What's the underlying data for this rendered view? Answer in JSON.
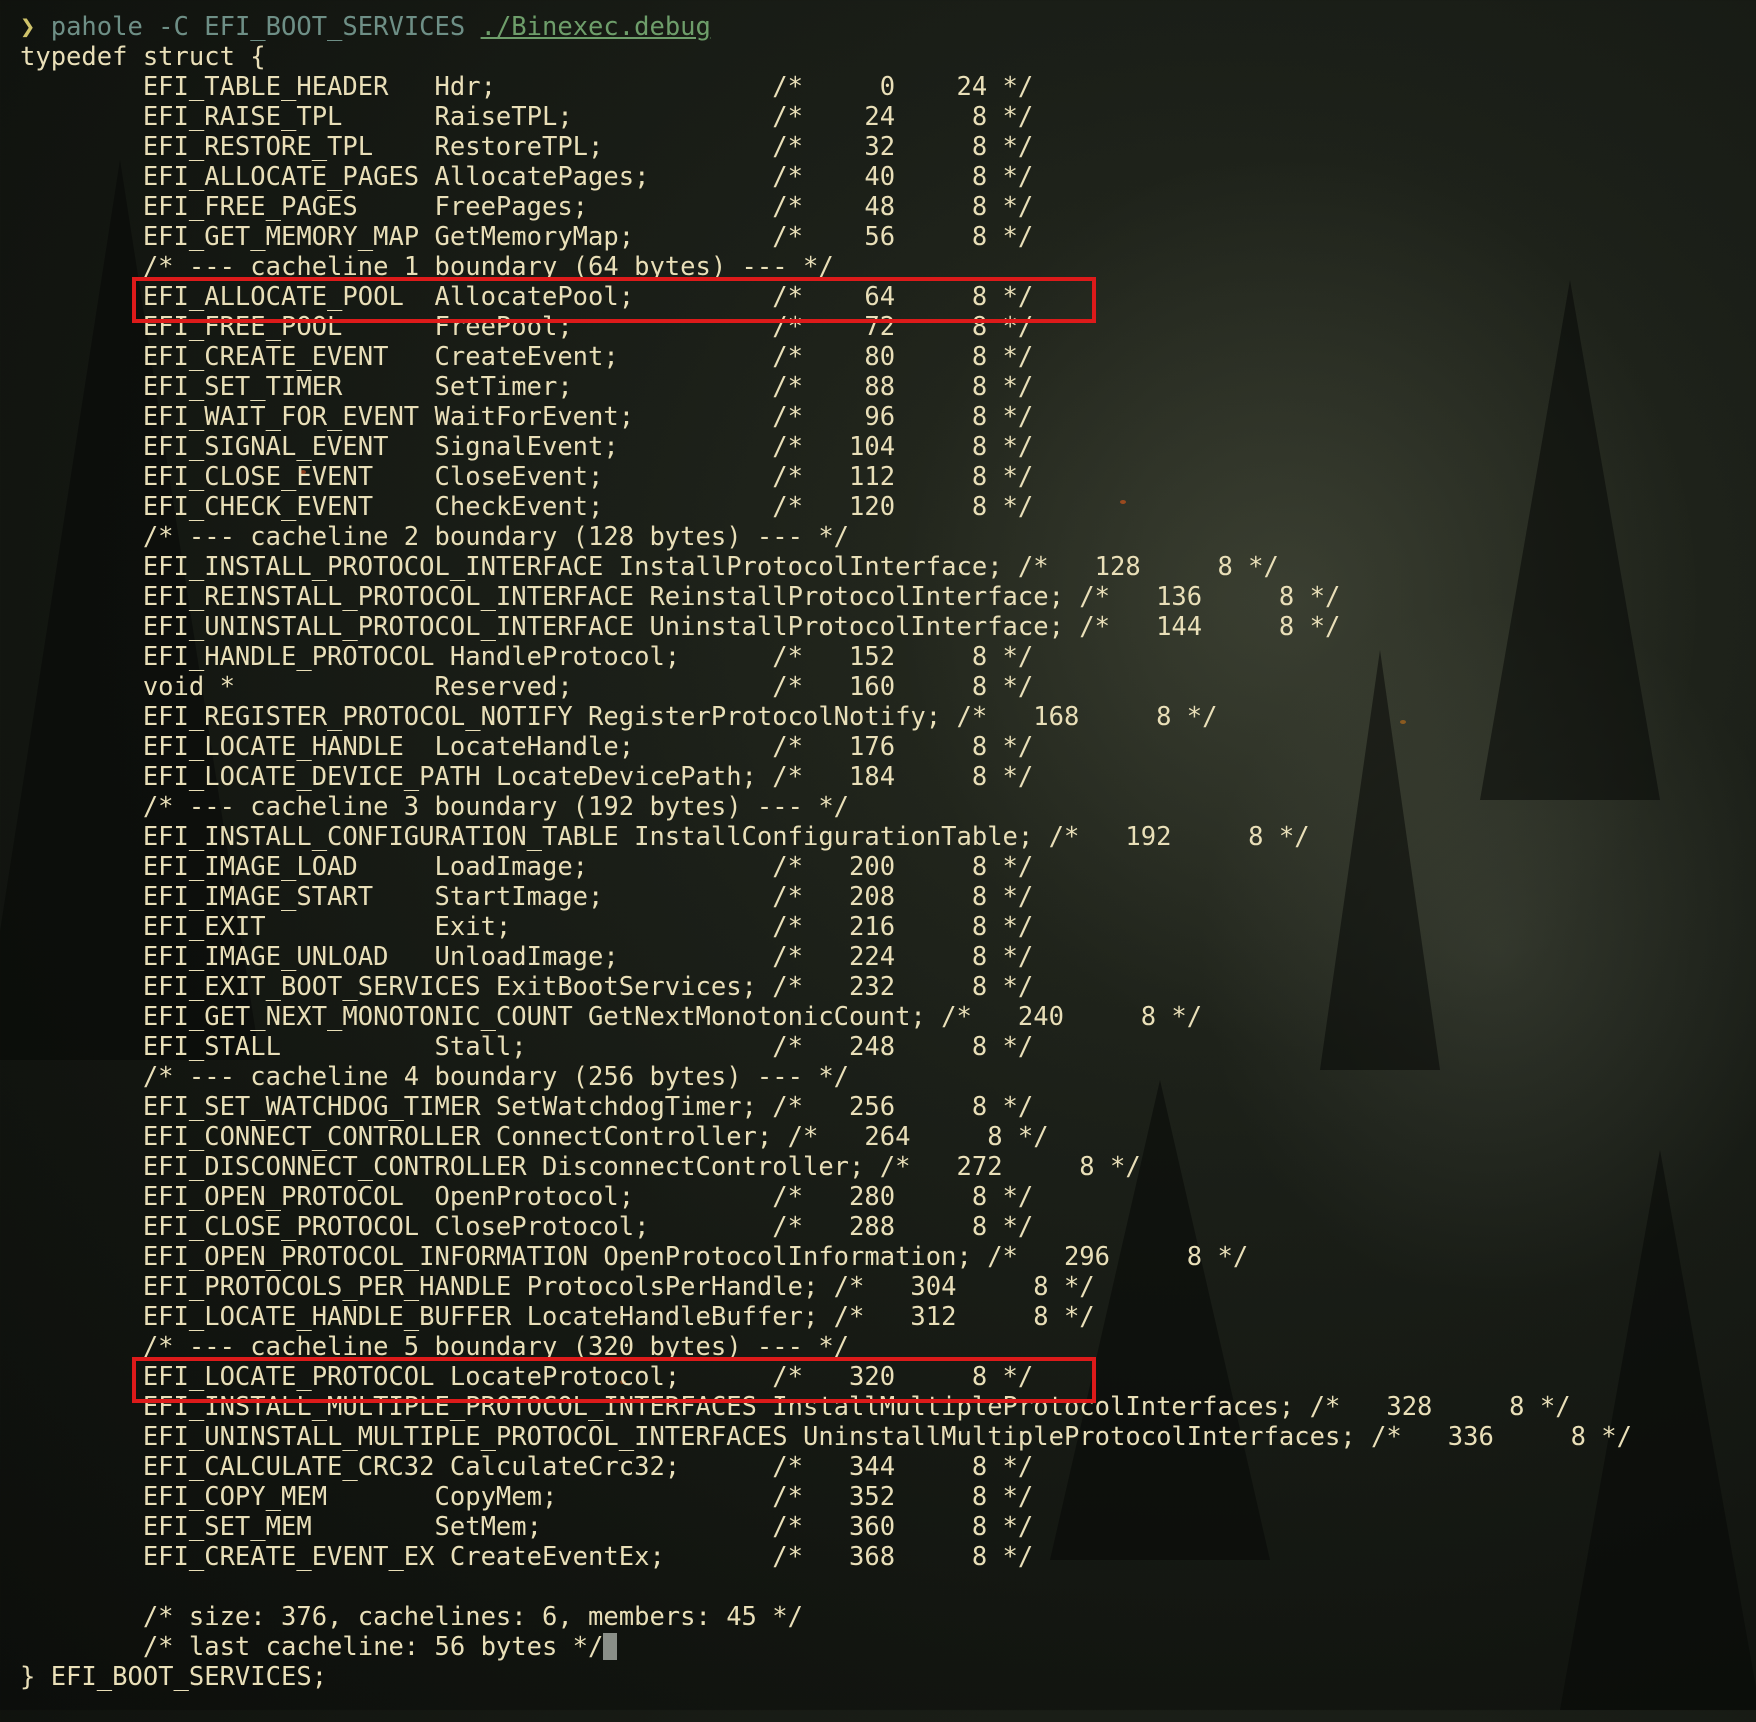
{
  "prompt": {
    "arrow": "❯",
    "command": "pahole -C EFI_BOOT_SERVICES",
    "path": "./Binexec.debug"
  },
  "header": "typedef struct {",
  "lines": [
    "        EFI_TABLE_HEADER   Hdr;                  /*     0    24 */",
    "        EFI_RAISE_TPL      RaiseTPL;             /*    24     8 */",
    "        EFI_RESTORE_TPL    RestoreTPL;           /*    32     8 */",
    "        EFI_ALLOCATE_PAGES AllocatePages;        /*    40     8 */",
    "        EFI_FREE_PAGES     FreePages;            /*    48     8 */",
    "        EFI_GET_MEMORY_MAP GetMemoryMap;         /*    56     8 */",
    "        /* --- cacheline 1 boundary (64 bytes) --- */",
    "        EFI_ALLOCATE_POOL  AllocatePool;         /*    64     8 */",
    "        EFI_FREE_POOL      FreePool;             /*    72     8 */",
    "        EFI_CREATE_EVENT   CreateEvent;          /*    80     8 */",
    "        EFI_SET_TIMER      SetTimer;             /*    88     8 */",
    "        EFI_WAIT_FOR_EVENT WaitForEvent;         /*    96     8 */",
    "        EFI_SIGNAL_EVENT   SignalEvent;          /*   104     8 */",
    "        EFI_CLOSE_EVENT    CloseEvent;           /*   112     8 */",
    "        EFI_CHECK_EVENT    CheckEvent;           /*   120     8 */",
    "        /* --- cacheline 2 boundary (128 bytes) --- */",
    "        EFI_INSTALL_PROTOCOL_INTERFACE InstallProtocolInterface; /*   128     8 */",
    "        EFI_REINSTALL_PROTOCOL_INTERFACE ReinstallProtocolInterface; /*   136     8 */",
    "        EFI_UNINSTALL_PROTOCOL_INTERFACE UninstallProtocolInterface; /*   144     8 */",
    "        EFI_HANDLE_PROTOCOL HandleProtocol;      /*   152     8 */",
    "        void *             Reserved;             /*   160     8 */",
    "        EFI_REGISTER_PROTOCOL_NOTIFY RegisterProtocolNotify; /*   168     8 */",
    "        EFI_LOCATE_HANDLE  LocateHandle;         /*   176     8 */",
    "        EFI_LOCATE_DEVICE_PATH LocateDevicePath; /*   184     8 */",
    "        /* --- cacheline 3 boundary (192 bytes) --- */",
    "        EFI_INSTALL_CONFIGURATION_TABLE InstallConfigurationTable; /*   192     8 */",
    "        EFI_IMAGE_LOAD     LoadImage;            /*   200     8 */",
    "        EFI_IMAGE_START    StartImage;           /*   208     8 */",
    "        EFI_EXIT           Exit;                 /*   216     8 */",
    "        EFI_IMAGE_UNLOAD   UnloadImage;          /*   224     8 */",
    "        EFI_EXIT_BOOT_SERVICES ExitBootServices; /*   232     8 */",
    "        EFI_GET_NEXT_MONOTONIC_COUNT GetNextMonotonicCount; /*   240     8 */",
    "        EFI_STALL          Stall;                /*   248     8 */",
    "        /* --- cacheline 4 boundary (256 bytes) --- */",
    "        EFI_SET_WATCHDOG_TIMER SetWatchdogTimer; /*   256     8 */",
    "        EFI_CONNECT_CONTROLLER ConnectController; /*   264     8 */",
    "        EFI_DISCONNECT_CONTROLLER DisconnectController; /*   272     8 */",
    "        EFI_OPEN_PROTOCOL  OpenProtocol;         /*   280     8 */",
    "        EFI_CLOSE_PROTOCOL CloseProtocol;        /*   288     8 */",
    "        EFI_OPEN_PROTOCOL_INFORMATION OpenProtocolInformation; /*   296     8 */",
    "        EFI_PROTOCOLS_PER_HANDLE ProtocolsPerHandle; /*   304     8 */",
    "        EFI_LOCATE_HANDLE_BUFFER LocateHandleBuffer; /*   312     8 */",
    "        /* --- cacheline 5 boundary (320 bytes) --- */",
    "        EFI_LOCATE_PROTOCOL LocateProtocol;      /*   320     8 */",
    "        EFI_INSTALL_MULTIPLE_PROTOCOL_INTERFACES InstallMultipleProtocolInterfaces; /*   328     8 */",
    "        EFI_UNINSTALL_MULTIPLE_PROTOCOL_INTERFACES UninstallMultipleProtocolInterfaces; /*   336     8 */",
    "        EFI_CALCULATE_CRC32 CalculateCrc32;      /*   344     8 */",
    "        EFI_COPY_MEM       CopyMem;              /*   352     8 */",
    "        EFI_SET_MEM        SetMem;               /*   360     8 */",
    "        EFI_CREATE_EVENT_EX CreateEventEx;       /*   368     8 */",
    "",
    "        /* size: 376, cachelines: 6, members: 45 */",
    "        /* last cacheline: 56 bytes */"
  ],
  "footer": "} EFI_BOOT_SERVICES;",
  "highlighted_lines": [
    7,
    43
  ],
  "colors": {
    "text": "#e9dfb8",
    "highlight_box": "#dd1a1a",
    "command": "#6e8f86",
    "path": "#6e9e6a"
  }
}
